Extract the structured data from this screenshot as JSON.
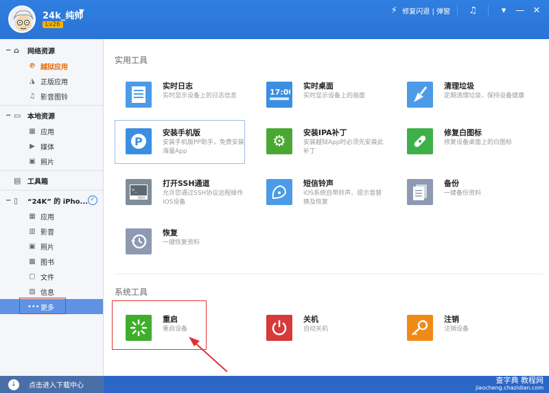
{
  "header": {
    "username": "24k_纯帅",
    "level": "Lv26",
    "right_text": "修复闪退 | 弹窗"
  },
  "sidebar": {
    "sections": [
      {
        "label": "网络资源",
        "items": [
          {
            "label": "越狱应用",
            "active": true
          },
          {
            "label": "正版应用"
          },
          {
            "label": "影音图铃"
          }
        ]
      },
      {
        "label": "本地资源",
        "items": [
          {
            "label": "应用"
          },
          {
            "label": "媒体"
          },
          {
            "label": "照片"
          }
        ]
      },
      {
        "label": "工具箱"
      },
      {
        "label": "“24K” 的 iPho...",
        "items": [
          {
            "label": "应用"
          },
          {
            "label": "影音"
          },
          {
            "label": "照片"
          },
          {
            "label": "图书"
          },
          {
            "label": "文件"
          },
          {
            "label": "信息"
          },
          {
            "label": "更多",
            "selected": true
          }
        ]
      }
    ],
    "download_label": "点击进入下载中心"
  },
  "main": {
    "practical_title": "实用工具",
    "system_title": "系统工具",
    "tools": [
      {
        "name": "实时日志",
        "desc": "实时显示设备上的日志信息",
        "color": "#4c9be6",
        "icon": "log-icon"
      },
      {
        "name": "实时桌面",
        "desc": "实时显示设备上的画面",
        "color": "#3a8fe0",
        "icon": "desktop-icon"
      },
      {
        "name": "清理垃圾",
        "desc": "定期清理垃圾，保持设备健康",
        "color": "#4c9be6",
        "icon": "broom-icon"
      },
      {
        "name": "安装手机版",
        "desc": "安装手机版PP助手，免费安装海量App",
        "color": "#3a8fe0",
        "icon": "pp-icon"
      },
      {
        "name": "安装IPA补丁",
        "desc": "安装越狱App时必须先安装此补丁",
        "color": "#4aa832",
        "icon": "gear-icon"
      },
      {
        "name": "修复白图标",
        "desc": "修复设备桌面上的白图标",
        "color": "#3eb04a",
        "icon": "bandage-icon"
      },
      {
        "name": "打开SSH通道",
        "desc": "允许您通过SSH协议远程操作iOS设备",
        "color": "#7f8c99",
        "icon": "ssh-icon"
      },
      {
        "name": "短信铃声",
        "desc": "iOS系统自带铃声、提示音替换及恢复",
        "color": "#4c9be6",
        "icon": "bell-icon"
      },
      {
        "name": "备份",
        "desc": "一键备份资料",
        "color": "#8e9ab3",
        "icon": "backup-icon"
      },
      {
        "name": "恢复",
        "desc": "一键恢复资料",
        "color": "#8e9ab3",
        "icon": "restore-icon"
      }
    ],
    "system_tools": [
      {
        "name": "重启",
        "desc": "重启设备",
        "color": "#3fae2a",
        "icon": "restart-icon"
      },
      {
        "name": "关机",
        "desc": "自动关机",
        "color": "#d63a3a",
        "icon": "power-icon"
      },
      {
        "name": "注销",
        "desc": "注销设备",
        "color": "#f08a16",
        "icon": "key-icon"
      }
    ]
  },
  "watermark": {
    "line1": "查字典 教程网",
    "line2": "jiaocheng.chazidian.com"
  }
}
